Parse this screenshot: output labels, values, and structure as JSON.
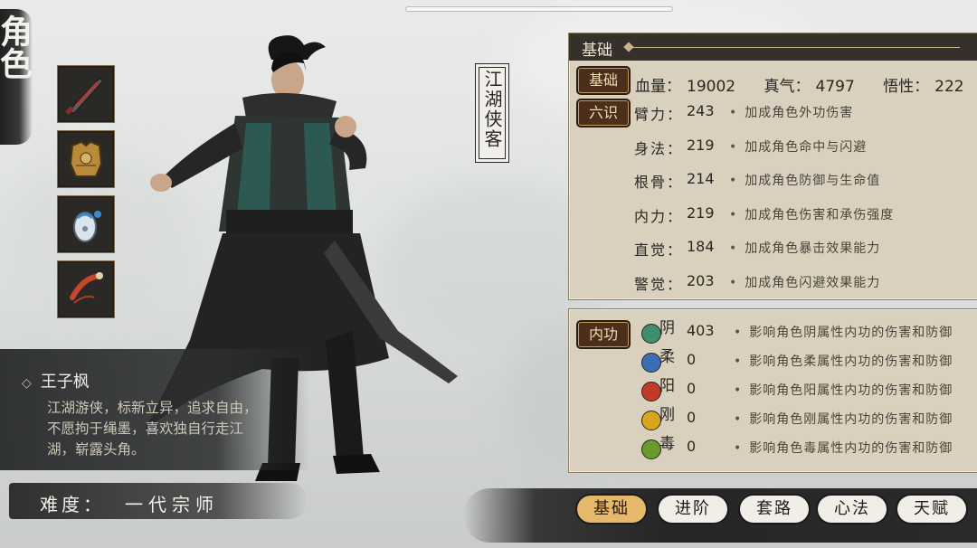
{
  "page": {
    "title": "角色"
  },
  "equipment": [
    {
      "name": "weapon-saber-icon"
    },
    {
      "name": "armor-icon"
    },
    {
      "name": "accessory-pouch-icon"
    },
    {
      "name": "gourd-icon"
    }
  ],
  "hero": {
    "title": "江湖侠客",
    "name": "王子枫",
    "description": "江湖游侠，标新立异，追求自由，不愿拘于绳墨，喜欢独自行走江湖，崭露头角。",
    "difficulty_label": "难度：",
    "difficulty_value": "一代宗师"
  },
  "basic_panel": {
    "header": "基础",
    "basic_tag": "基础",
    "stats": [
      {
        "label": "血量：",
        "value": "19002"
      },
      {
        "label": "真气：",
        "value": "4797"
      },
      {
        "label": "悟性：",
        "value": "222"
      }
    ],
    "six_tag": "六识",
    "six_stats": [
      {
        "label": "臂力：",
        "value": "243",
        "desc": "加成角色外功伤害"
      },
      {
        "label": "身法：",
        "value": "219",
        "desc": "加成角色命中与闪避"
      },
      {
        "label": "根骨：",
        "value": "214",
        "desc": "加成角色防御与生命值"
      },
      {
        "label": "内力：",
        "value": "219",
        "desc": "加成角色伤害和承伤强度"
      },
      {
        "label": "直觉：",
        "value": "184",
        "desc": "加成角色暴击效果能力"
      },
      {
        "label": "警觉：",
        "value": "203",
        "desc": "加成角色闪避效果能力"
      }
    ]
  },
  "inner_panel": {
    "tag": "内功",
    "rows": [
      {
        "label": "阴",
        "value": "403",
        "desc": "影响角色阴属性内功的伤害和防御",
        "color": "#3f8f6e"
      },
      {
        "label": "柔",
        "value": "0",
        "desc": "影响角色柔属性内功的伤害和防御",
        "color": "#3b6fb5"
      },
      {
        "label": "阳",
        "value": "0",
        "desc": "影响角色阳属性内功的伤害和防御",
        "color": "#c23a2a"
      },
      {
        "label": "刚",
        "value": "0",
        "desc": "影响角色刚属性内功的伤害和防御",
        "color": "#d9a51f"
      },
      {
        "label": "毒",
        "value": "0",
        "desc": "影响角色毒属性内功的伤害和防御",
        "color": "#6a9a2e"
      }
    ]
  },
  "tabs": [
    "基础",
    "进阶",
    "套路",
    "心法",
    "天赋"
  ],
  "colors": {
    "accent": "#e6b86a",
    "panel": "#d9d1bd",
    "dark": "#35302a"
  }
}
